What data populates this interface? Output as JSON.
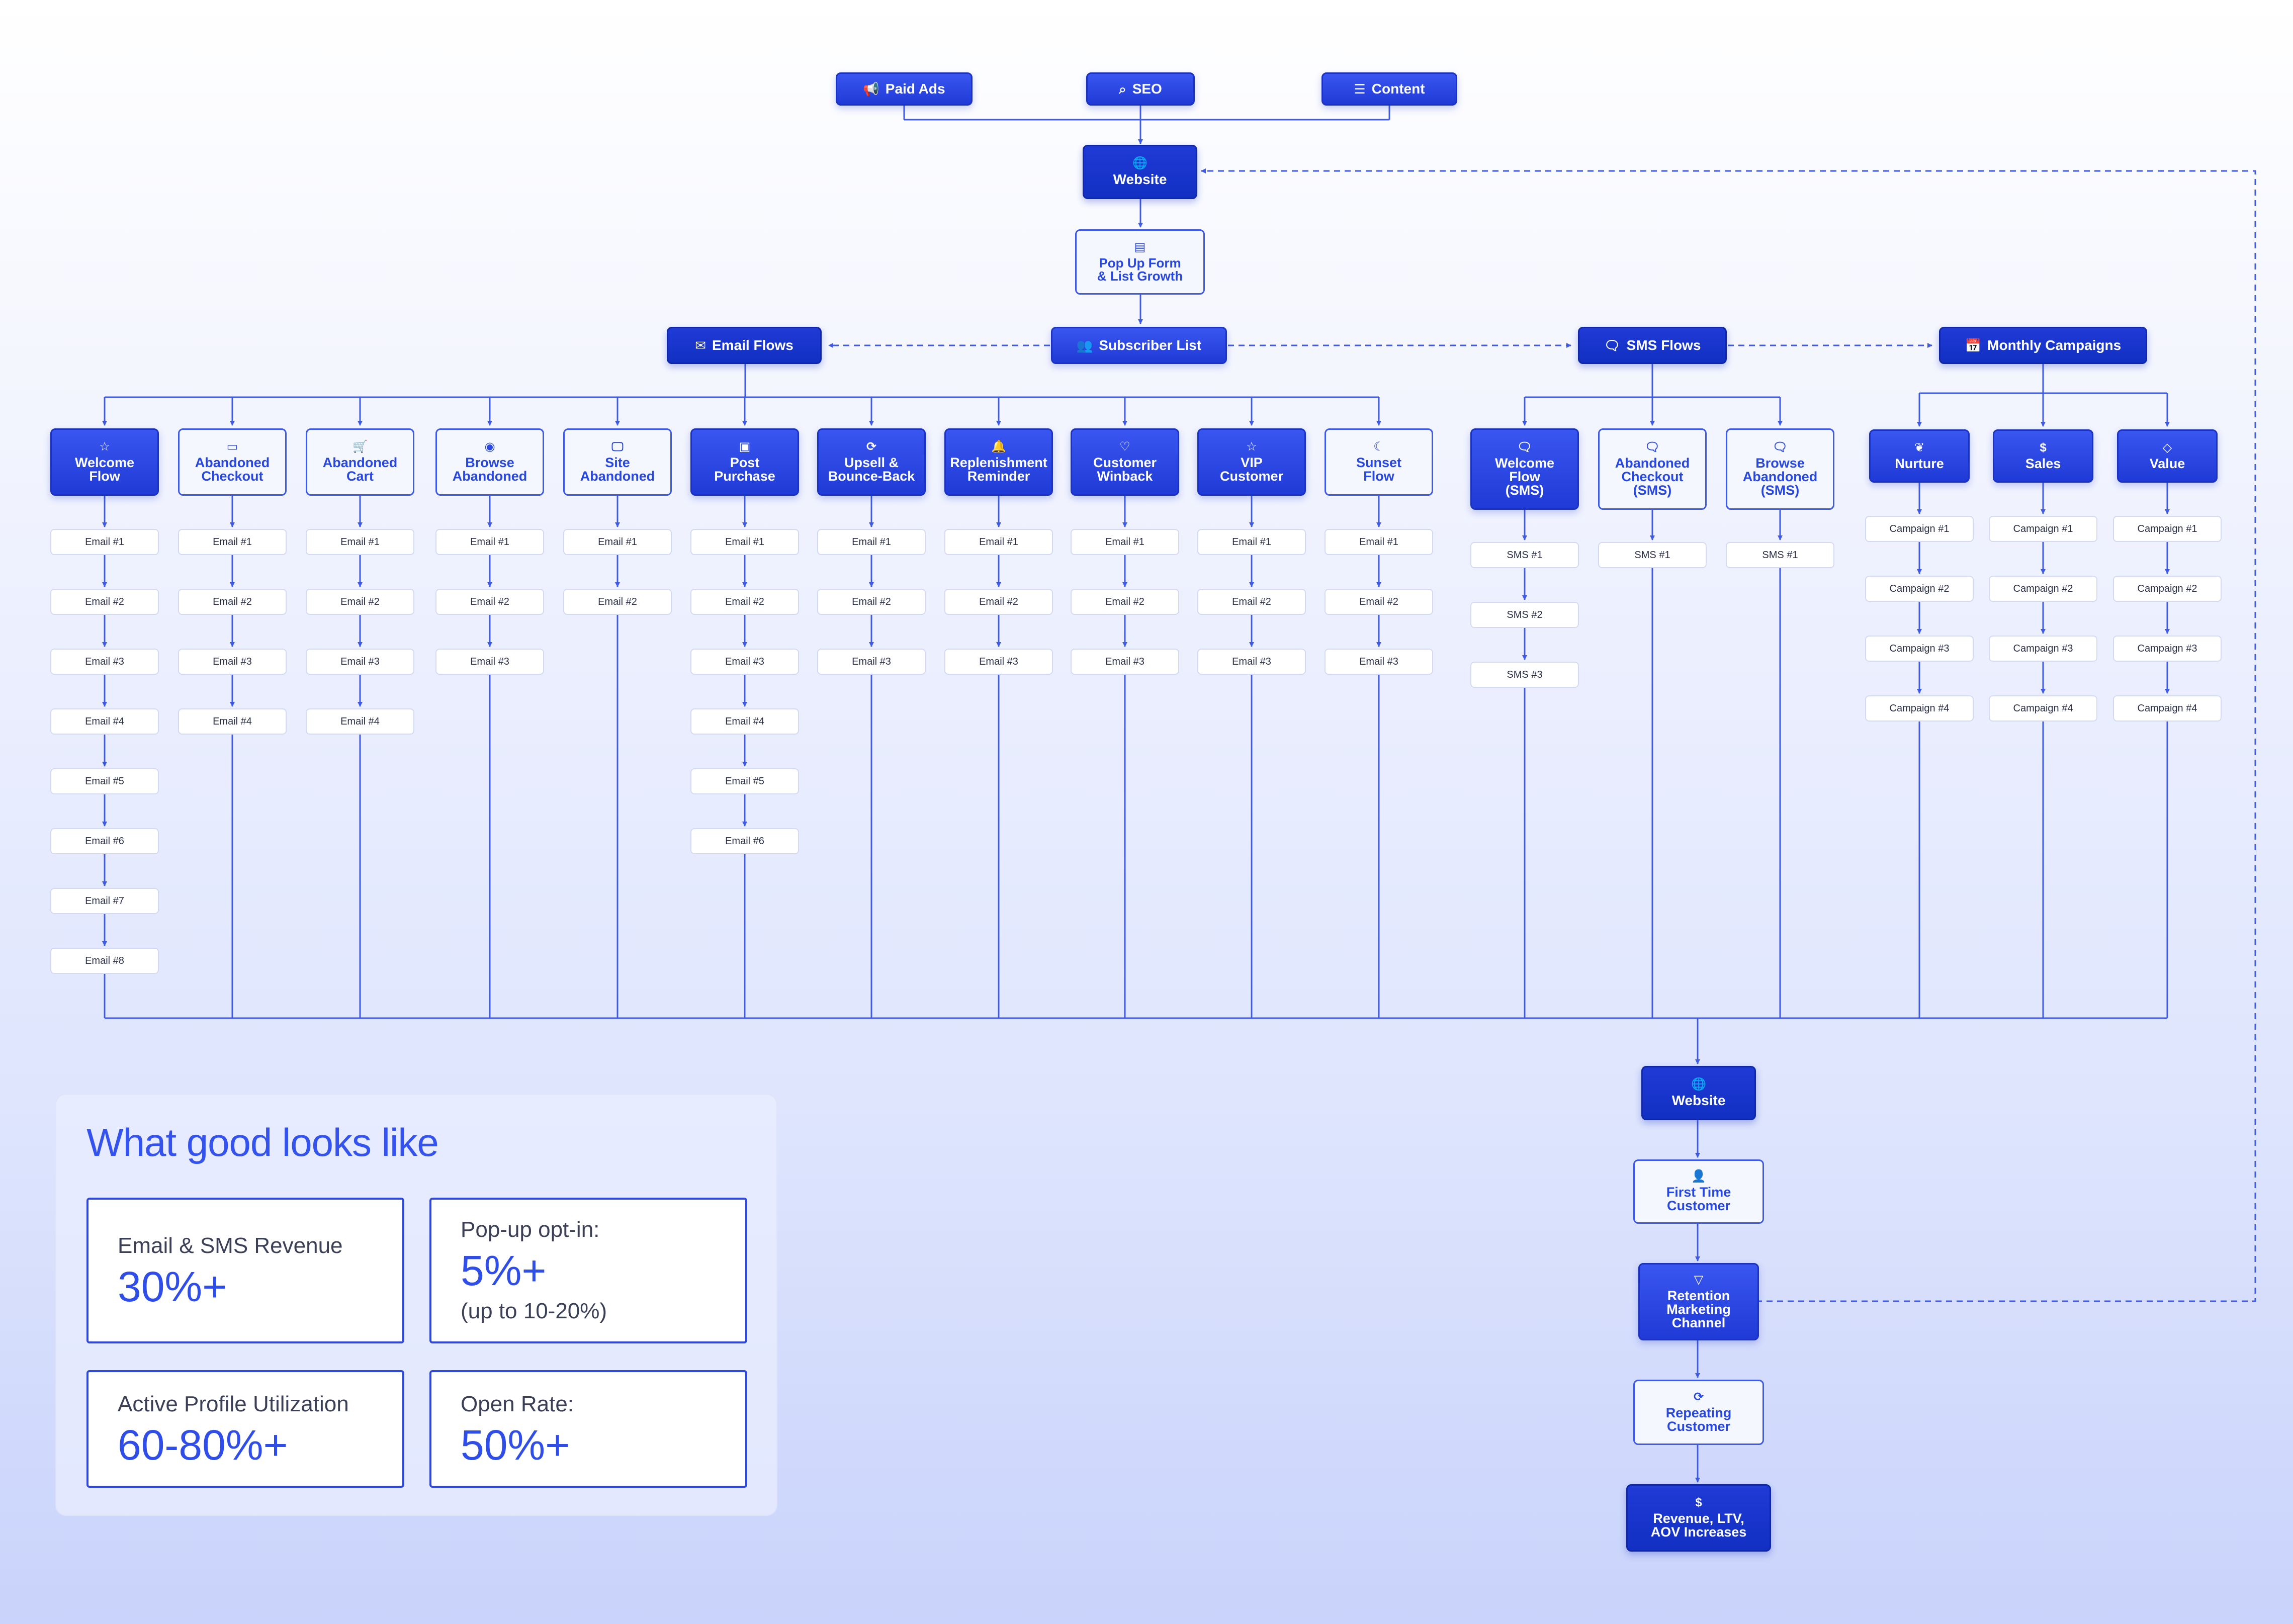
{
  "colors": {
    "accent": "#2f4de8",
    "wire": "#3f5be6",
    "node_dark": "#1f3ad6",
    "node_light": "#3a56f0"
  },
  "sources": [
    {
      "label": "Paid Ads",
      "icon": "megaphone-icon"
    },
    {
      "label": "SEO",
      "icon": "search-icon"
    },
    {
      "label": "Content",
      "icon": "document-icon"
    }
  ],
  "website_top": {
    "label": "Website",
    "icon": "globe-icon"
  },
  "popup": {
    "label": "Pop Up Form\n& List Growth",
    "icon": "form-icon"
  },
  "subscriber": {
    "label": "Subscriber List",
    "icon": "users-icon"
  },
  "email_flows": {
    "label": "Email Flows",
    "icon": "mail-icon"
  },
  "sms_flows": {
    "label": "SMS Flows",
    "icon": "chat-icon"
  },
  "monthly": {
    "label": "Monthly Campaigns",
    "icon": "calendar-icon"
  },
  "email_columns": [
    {
      "title": "Welcome\nFlow",
      "icon": "star-icon",
      "style": "solid",
      "items": [
        "Email #1",
        "Email #2",
        "Email #3",
        "Email #4",
        "Email #5",
        "Email #6",
        "Email #7",
        "Email #8"
      ]
    },
    {
      "title": "Abandoned\nCheckout",
      "icon": "card-icon",
      "style": "outline",
      "items": [
        "Email #1",
        "Email #2",
        "Email #3",
        "Email #4"
      ]
    },
    {
      "title": "Abandoned\nCart",
      "icon": "cart-icon",
      "style": "outline",
      "items": [
        "Email #1",
        "Email #2",
        "Email #3",
        "Email #4"
      ]
    },
    {
      "title": "Browse\nAbandoned",
      "icon": "eye-icon",
      "style": "outline",
      "items": [
        "Email #1",
        "Email #2",
        "Email #3"
      ]
    },
    {
      "title": "Site\nAbandoned",
      "icon": "monitor-icon",
      "style": "outline",
      "items": [
        "Email #1",
        "Email #2"
      ]
    },
    {
      "title": "Post\nPurchase",
      "icon": "bag-icon",
      "style": "solid",
      "items": [
        "Email #1",
        "Email #2",
        "Email #3",
        "Email #4",
        "Email #5",
        "Email #6"
      ]
    },
    {
      "title": "Upsell &\nBounce-Back",
      "icon": "refresh-icon",
      "style": "solid",
      "items": [
        "Email #1",
        "Email #2",
        "Email #3"
      ]
    },
    {
      "title": "Replenishment\nReminder",
      "icon": "bell-icon",
      "style": "solid",
      "items": [
        "Email #1",
        "Email #2",
        "Email #3"
      ]
    },
    {
      "title": "Customer\nWinback",
      "icon": "heart-icon",
      "style": "solid",
      "items": [
        "Email #1",
        "Email #2",
        "Email #3"
      ]
    },
    {
      "title": "VIP\nCustomer",
      "icon": "star-icon",
      "style": "solid",
      "items": [
        "Email #1",
        "Email #2",
        "Email #3"
      ]
    },
    {
      "title": "Sunset\nFlow",
      "icon": "moon-icon",
      "style": "outline",
      "items": [
        "Email #1",
        "Email #2",
        "Email #3"
      ]
    }
  ],
  "sms_columns": [
    {
      "title": "Welcome\nFlow\n(SMS)",
      "icon": "chat-icon",
      "style": "solid",
      "items": [
        "SMS #1",
        "SMS #2",
        "SMS #3"
      ]
    },
    {
      "title": "Abandoned\nCheckout\n(SMS)",
      "icon": "chat-icon",
      "style": "outline",
      "items": [
        "SMS #1"
      ]
    },
    {
      "title": "Browse\nAbandoned\n(SMS)",
      "icon": "chat-icon",
      "style": "outline",
      "items": [
        "SMS #1"
      ]
    }
  ],
  "campaign_columns": [
    {
      "title": "Nurture",
      "icon": "leaf-icon",
      "style": "solid",
      "items": [
        "Campaign #1",
        "Campaign #2",
        "Campaign #3",
        "Campaign #4"
      ]
    },
    {
      "title": "Sales",
      "icon": "dollar-icon",
      "style": "solid",
      "items": [
        "Campaign #1",
        "Campaign #2",
        "Campaign #3",
        "Campaign #4"
      ]
    },
    {
      "title": "Value",
      "icon": "diamond-icon",
      "style": "solid",
      "items": [
        "Campaign #1",
        "Campaign #2",
        "Campaign #3",
        "Campaign #4"
      ]
    }
  ],
  "bottom_chain": [
    {
      "label": "Website",
      "icon": "globe-icon",
      "style": "dark"
    },
    {
      "label": "First Time\nCustomer",
      "icon": "user-icon",
      "style": "outline"
    },
    {
      "label": "Retention\nMarketing\nChannel",
      "icon": "filter-icon",
      "style": "solid"
    },
    {
      "label": "Repeating\nCustomer",
      "icon": "refresh-icon",
      "style": "outline"
    },
    {
      "label": "Revenue, LTV,\nAOV Increases",
      "icon": "dollar-icon",
      "style": "dark"
    }
  ],
  "panel": {
    "title": "What good looks like",
    "cards": [
      {
        "label": "Email & SMS Revenue",
        "value": "30%+",
        "note": ""
      },
      {
        "label": "Pop-up opt-in:",
        "value": "5%+",
        "note": "(up to 10-20%)"
      },
      {
        "label": "Active Profile Utilization",
        "value": "60-80%+",
        "note": ""
      },
      {
        "label": "Open Rate:",
        "value": "50%+",
        "note": ""
      }
    ]
  }
}
